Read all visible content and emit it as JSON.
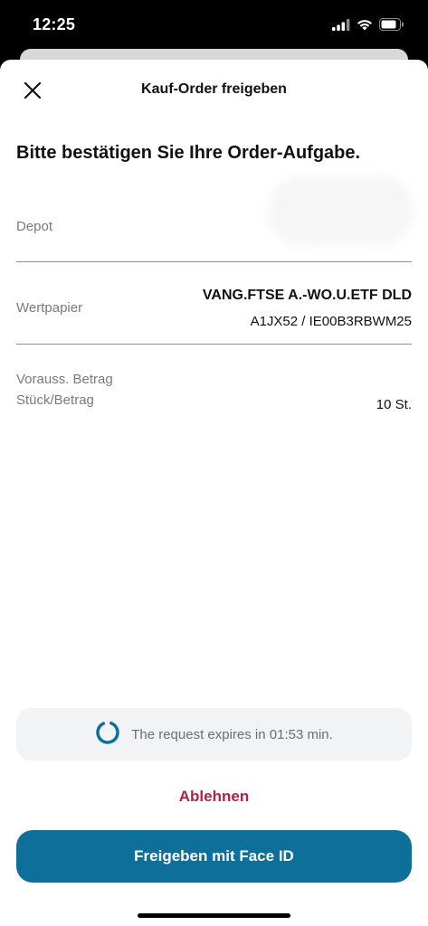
{
  "status_bar": {
    "time": "12:25"
  },
  "header": {
    "title": "Kauf-Order freigeben"
  },
  "heading": "Bitte bestätigen Sie Ihre Order-Aufgabe.",
  "rows": {
    "depot_label": "Depot",
    "wertpapier_label": "Wertpapier",
    "wertpapier_name": "VANG.FTSE A.-WO.U.ETF DLD",
    "wertpapier_ids": "A1JX52 / IE00B3RBWM25",
    "betrag_label": "Vorauss. Betrag",
    "stueck_label": "Stück/Betrag",
    "stueck_value": "10 St."
  },
  "expiry": {
    "text": "The request expires in 01:53 min."
  },
  "actions": {
    "reject_label": "Ablehnen",
    "approve_label": "Freigeben mit Face ID"
  },
  "colors": {
    "primary": "#0d6f9a",
    "reject": "#b3204a",
    "expiry_bg": "#f2f3f5"
  },
  "icons": {
    "close": "close-icon",
    "spinner": "spinner-icon",
    "signal": "cellular-signal-icon",
    "wifi": "wifi-icon",
    "battery": "battery-icon"
  }
}
